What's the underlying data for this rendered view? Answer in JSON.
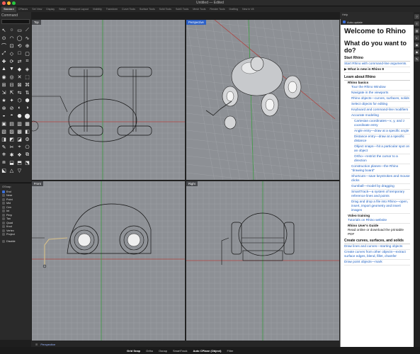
{
  "window": {
    "title": "Untitled — Edited"
  },
  "tabs": [
    "Standard",
    "CPlanes",
    "Set View",
    "Display",
    "Select",
    "Viewport Layout",
    "Visibility",
    "Transform",
    "Curve Tools",
    "Surface Tools",
    "Solid Tools",
    "SubD Tools",
    "Mesh Tools",
    "Render Tools",
    "Drafting",
    "New in V8"
  ],
  "command": {
    "label": "Command",
    "value": ""
  },
  "tools": [
    "↖",
    "○",
    "▭",
    "⟋",
    "⊙",
    "◠",
    "◯",
    "∿",
    "⌒",
    "⊡",
    "⟲",
    "⊕",
    "⤢",
    "◇",
    "□",
    "▢",
    "✚",
    "⟳",
    "⇄",
    "⌗",
    "▲",
    "▼",
    "◆",
    "◈",
    "◉",
    "◎",
    "✕",
    "⬚",
    "⊞",
    "⊟",
    "⊠",
    "⌘",
    "⇲",
    "⇱",
    "⇆",
    "⇅",
    "★",
    "✦",
    "⬡",
    "⬢",
    "⊗",
    "⊘",
    "◐",
    "◑",
    "◒",
    "◓",
    "⬣",
    "⬤",
    "▣",
    "▤",
    "▥",
    "▦",
    "▧",
    "▨",
    "▩",
    "◧",
    "◨",
    "◩",
    "◪",
    "⚙",
    "✎",
    "✂",
    "⌖",
    "⎔",
    "⎈",
    "✱",
    "❖",
    "⧉",
    "⧈",
    "⬓",
    "⬒",
    "⬔",
    "⬕",
    "△",
    "▽"
  ],
  "osnap": {
    "title": "OSnap",
    "items": [
      {
        "label": "End",
        "on": true
      },
      {
        "label": "Near",
        "on": false
      },
      {
        "label": "Point",
        "on": false
      },
      {
        "label": "Mid",
        "on": false
      },
      {
        "label": "Cen",
        "on": false
      },
      {
        "label": "Int",
        "on": false
      },
      {
        "label": "Perp",
        "on": false
      },
      {
        "label": "Tan",
        "on": false
      },
      {
        "label": "Quad",
        "on": false
      },
      {
        "label": "Knot",
        "on": false
      },
      {
        "label": "Vertex",
        "on": false
      },
      {
        "label": "Project",
        "on": false
      },
      {
        "label": "Disable",
        "on": false
      }
    ]
  },
  "viewports": {
    "top": "Top",
    "perspective": "Perspective",
    "front": "Front",
    "right": "Right"
  },
  "help": {
    "panel_label": "Help",
    "auto_update": "Auto-update",
    "title": "Welcome to Rhino",
    "subtitle": "What do you want to do?",
    "start_heading": "Start Rhino",
    "start_link": "Start Rhino with command-line arguments.",
    "whats_new": "What is new in Rhino 8",
    "learn_heading": "Learn about Rhino",
    "basics": "Rhino basics",
    "items": [
      {
        "t": "Tour the Rhino Window",
        "lvl": 2
      },
      {
        "t": "Navigate in the viewports",
        "lvl": 2
      },
      {
        "t": "Rhino objects—curves, surfaces, solids",
        "lvl": 2
      },
      {
        "t": "Select objects for editing",
        "lvl": 2
      },
      {
        "t": "Keyboard and command-line modifiers",
        "lvl": 2
      },
      {
        "t": "Accurate modeling",
        "lvl": 2
      },
      {
        "t": "Cartesian coordinates—x, y, and z coordinate entry",
        "lvl": 3
      },
      {
        "t": "Angle entry—draw at a specific angle",
        "lvl": 3
      },
      {
        "t": "Distance entry—draw at a specific distance",
        "lvl": 3
      },
      {
        "t": "Object snaps—hit a particular spot on an object",
        "lvl": 3
      },
      {
        "t": "Ortho—restrict the cursor to a direction",
        "lvl": 3
      },
      {
        "t": "Construction planes—the Rhino \"drawing board\"",
        "lvl": 2
      },
      {
        "t": "Shortcuts—save keystrokes and mouse clicks",
        "lvl": 2
      },
      {
        "t": "Gumball—model by dragging",
        "lvl": 2
      },
      {
        "t": "SmartTrack—a system of temporary reference lines and points",
        "lvl": 2
      },
      {
        "t": "Drag and drop a file into Rhino—open, insert, import geometry and insert images",
        "lvl": 2
      }
    ],
    "video_heading": "Video training",
    "video_link": "Tutorials on Rhino website",
    "guide_heading": "Rhino User's Guide",
    "guide_text": "Read online or download the printable PDF",
    "create_heading": "Create curves, surfaces, and solids",
    "create_items": [
      "Draw lines and curves—starting objects",
      "Create curves from other objects—extract surface edges, blend, fillet, chamfer",
      "Draw point objects—mark"
    ]
  },
  "status": {
    "viewport_tab": "Perspective"
  },
  "bottom": [
    "Grid Snap",
    "Ortho",
    "Osnap",
    "SmartTrack",
    "Auto CPlane (Object)",
    "Filter"
  ]
}
